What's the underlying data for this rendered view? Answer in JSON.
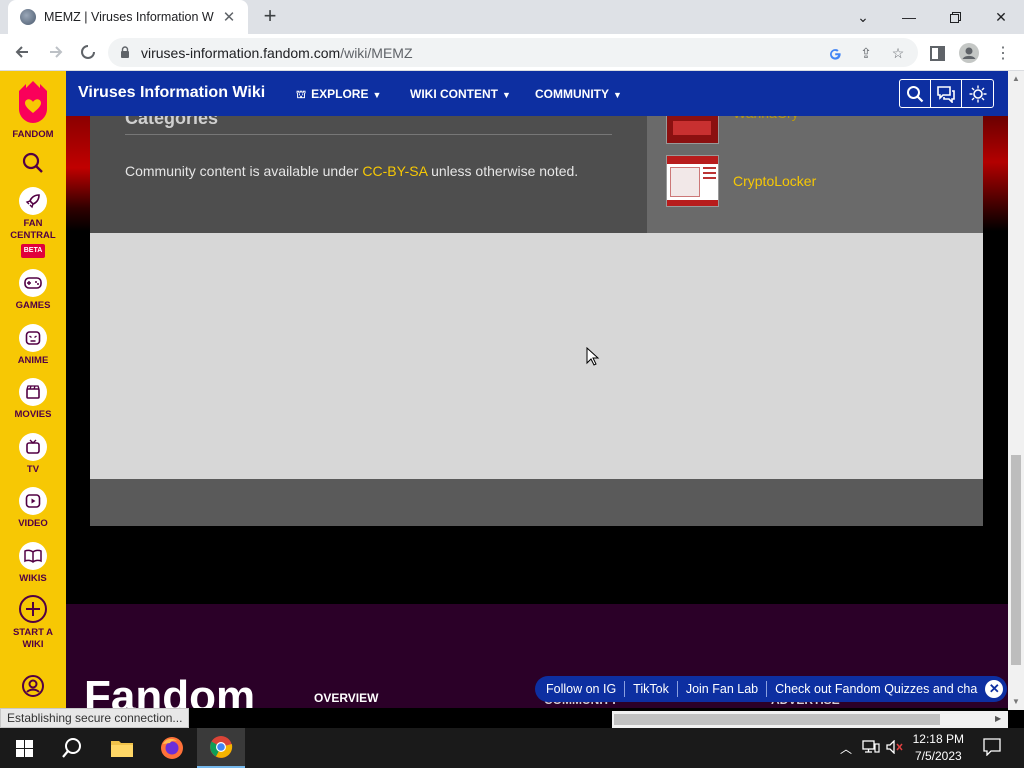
{
  "browser": {
    "tab_title": "MEMZ | Viruses Information Wiki",
    "url_domain": "viruses-information.fandom.com",
    "url_path": "/wiki/MEMZ",
    "status_text": "Establishing secure connection..."
  },
  "fandom_sidebar": {
    "brand": "FANDOM",
    "items": [
      {
        "label": "FAN CENTRAL",
        "badge": "BETA",
        "icon": "rocket-icon"
      },
      {
        "label": "GAMES",
        "icon": "gamepad-icon"
      },
      {
        "label": "ANIME",
        "icon": "anime-face-icon"
      },
      {
        "label": "MOVIES",
        "icon": "clapperboard-icon"
      },
      {
        "label": "TV",
        "icon": "tv-icon"
      },
      {
        "label": "VIDEO",
        "icon": "play-icon"
      },
      {
        "label": "WIKIS",
        "icon": "book-icon"
      },
      {
        "label": "START A WIKI",
        "icon": "plus-circle-icon"
      }
    ]
  },
  "wiki_header": {
    "name": "Viruses Information Wiki",
    "nav": [
      "EXPLORE",
      "WIKI CONTENT",
      "COMMUNITY"
    ]
  },
  "article": {
    "categories_heading": "Categories",
    "license_prefix": "Community content is available under ",
    "license_link": "CC-BY-SA",
    "license_suffix": " unless otherwise noted."
  },
  "rail": {
    "items": [
      {
        "title": "WannaCry"
      },
      {
        "title": "CryptoLocker"
      }
    ]
  },
  "footer": {
    "logo": "Fandom",
    "overview": "OVERVIEW",
    "col2": "COMMUNITY",
    "col3": "ADVERTISE"
  },
  "promo": {
    "items": [
      "Follow on IG",
      "TikTok",
      "Join Fan Lab",
      "Check out Fandom Quizzes and cha"
    ]
  },
  "taskbar": {
    "time": "12:18 PM",
    "date": "7/5/2023"
  },
  "colors": {
    "fandom_yellow": "#f7c804",
    "wiki_blue": "#0d2fa1",
    "footer_purple": "#2b0028"
  }
}
